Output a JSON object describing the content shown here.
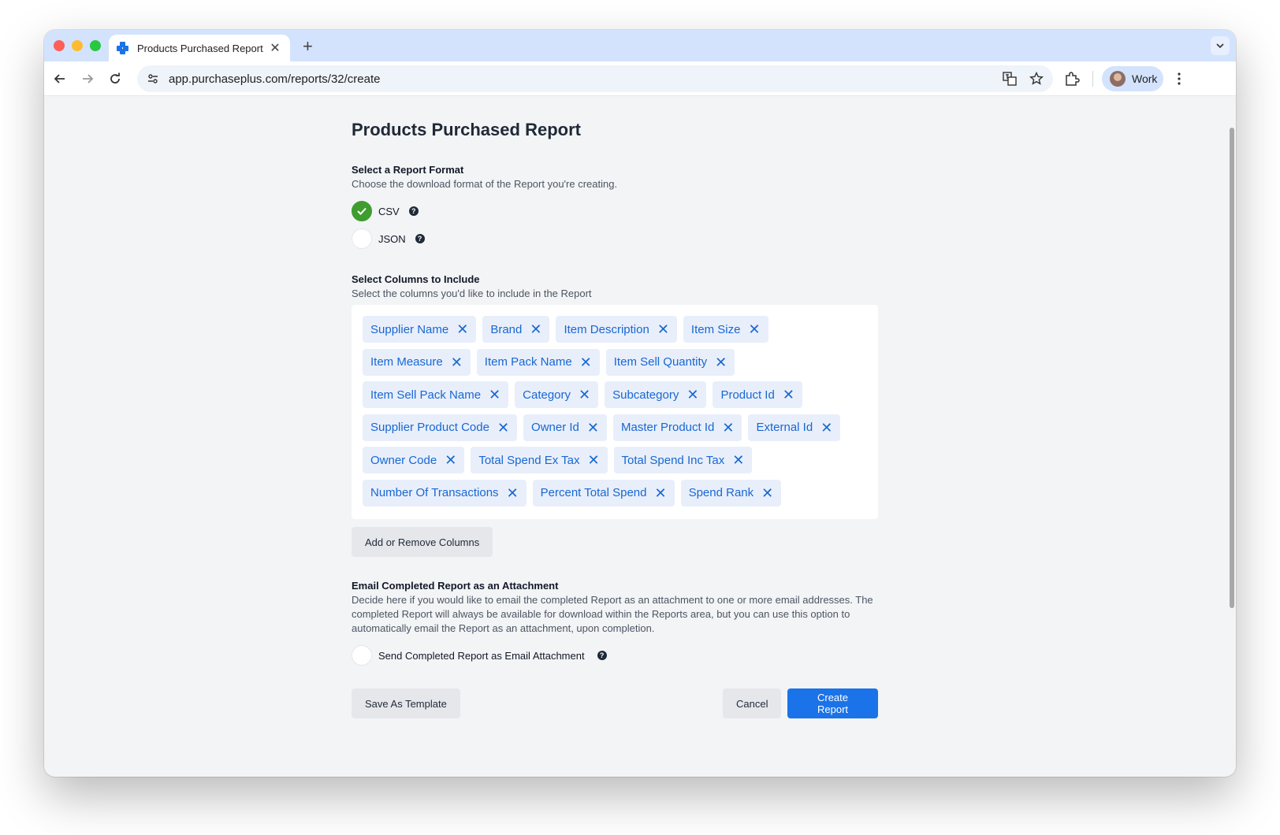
{
  "browser": {
    "tab_title": "Products Purchased Report",
    "tab_close_glyph": "✕",
    "new_tab_glyph": "+",
    "url": "app.purchaseplus.com/reports/32/create",
    "profile_name": "Work"
  },
  "page": {
    "title": "Products Purchased Report",
    "format": {
      "title": "Select a Report Format",
      "description": "Choose the download format of the Report you're creating.",
      "options": [
        {
          "label": "CSV",
          "selected": true
        },
        {
          "label": "JSON",
          "selected": false
        }
      ],
      "help_glyph": "?"
    },
    "columns": {
      "title": "Select Columns to Include",
      "description": "Select the columns you'd like to include in the Report",
      "rows": [
        [
          "Supplier Name",
          "Brand",
          "Item Description",
          "Item Size"
        ],
        [
          "Item Measure",
          "Item Pack Name",
          "Item Sell Quantity"
        ],
        [
          "Item Sell Pack Name",
          "Category",
          "Subcategory",
          "Product Id"
        ],
        [
          "Supplier Product Code",
          "Owner Id",
          "Master Product Id",
          "External Id"
        ],
        [
          "Owner Code",
          "Total Spend Ex Tax",
          "Total Spend Inc Tax"
        ],
        [
          "Number Of Transactions",
          "Percent Total Spend",
          "Spend Rank"
        ]
      ],
      "remove_glyph": "✕",
      "add_remove_button": "Add or Remove Columns"
    },
    "email": {
      "title": "Email Completed Report as an Attachment",
      "description": "Decide here if you would like to email the completed Report as an attachment to one or more email addresses. The completed Report will always be available for download within the Reports area, but you can use this option to automatically email the Report as an attachment, upon completion.",
      "checkbox_label": "Send Completed Report as Email Attachment",
      "checked": false
    },
    "actions": {
      "save_template": "Save As Template",
      "cancel": "Cancel",
      "create": "Create Report"
    }
  },
  "colors": {
    "accent": "#1a73e8",
    "chip_bg": "#e8effb",
    "chip_text": "#1967d2",
    "success": "#3f9d2f"
  }
}
